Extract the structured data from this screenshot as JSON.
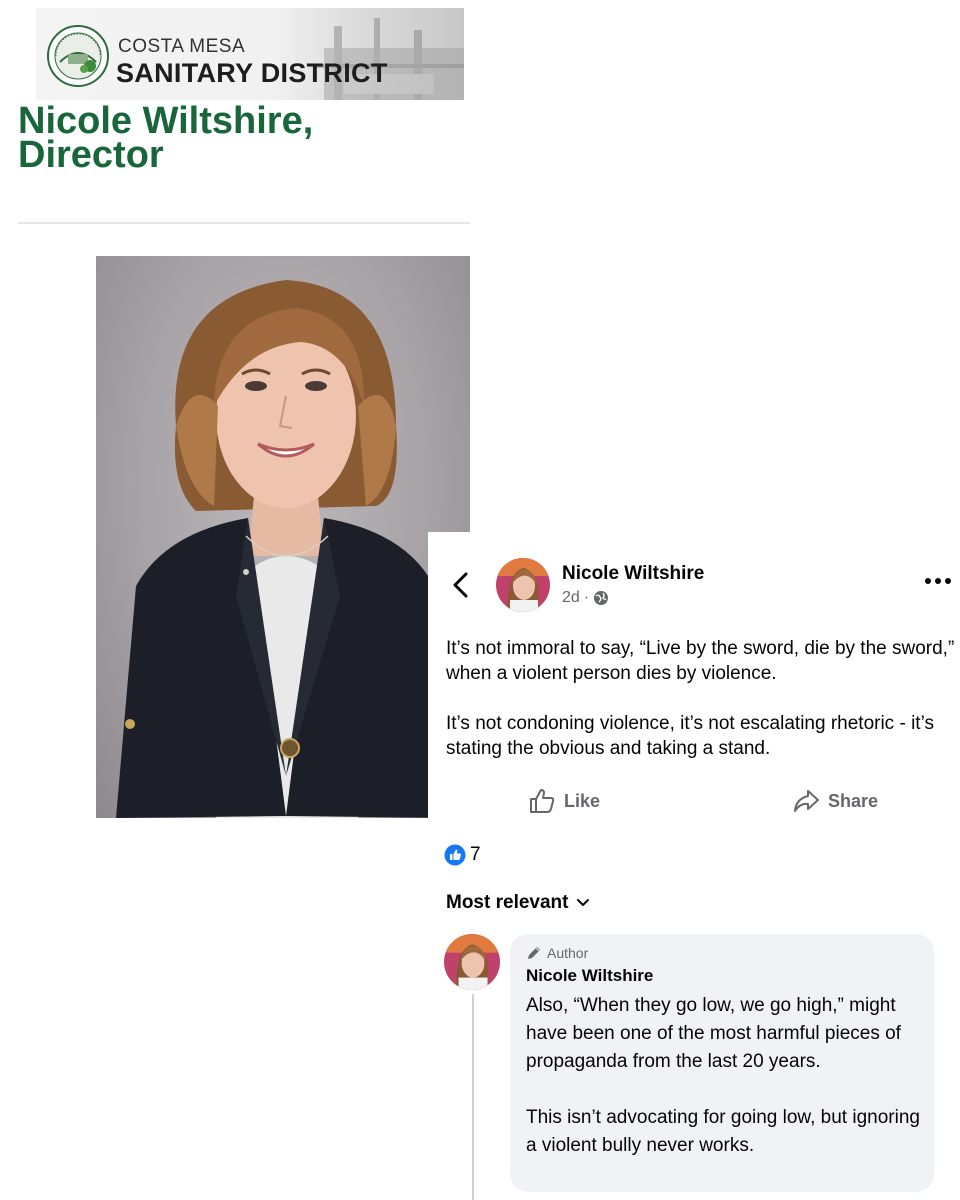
{
  "org": {
    "name_line1": "COSTA MESA",
    "name_line2": "SANITARY DISTRICT",
    "brand_color": "#19663a",
    "logo": "costa-mesa-sanitary-district-seal"
  },
  "profile": {
    "title": "Nicole Wiltshire, Director"
  },
  "post": {
    "author": "Nicole Wiltshire",
    "time": "2d",
    "audience_icon": "globe-icon",
    "paragraphs": [
      "It’s not immoral to say, “Live by the sword, die by the sword,” when a violent person dies by violence.",
      "It’s not condoning violence, it’s not escalating rhetoric - it’s stating the obvious and taking a stand."
    ],
    "actions": {
      "like": "Like",
      "share": "Share"
    },
    "reaction_count": "7",
    "sort_label": "Most relevant",
    "accent_color": "#1877f2"
  },
  "comment": {
    "badge": "Author",
    "author": "Nicole Wiltshire",
    "paragraphs": [
      "Also, “When they go low, we go high,” might have been one of the most harmful pieces of propaganda from the last 20 years.",
      "This isn’t advocating for going low, but ignoring a violent bully never works."
    ]
  }
}
